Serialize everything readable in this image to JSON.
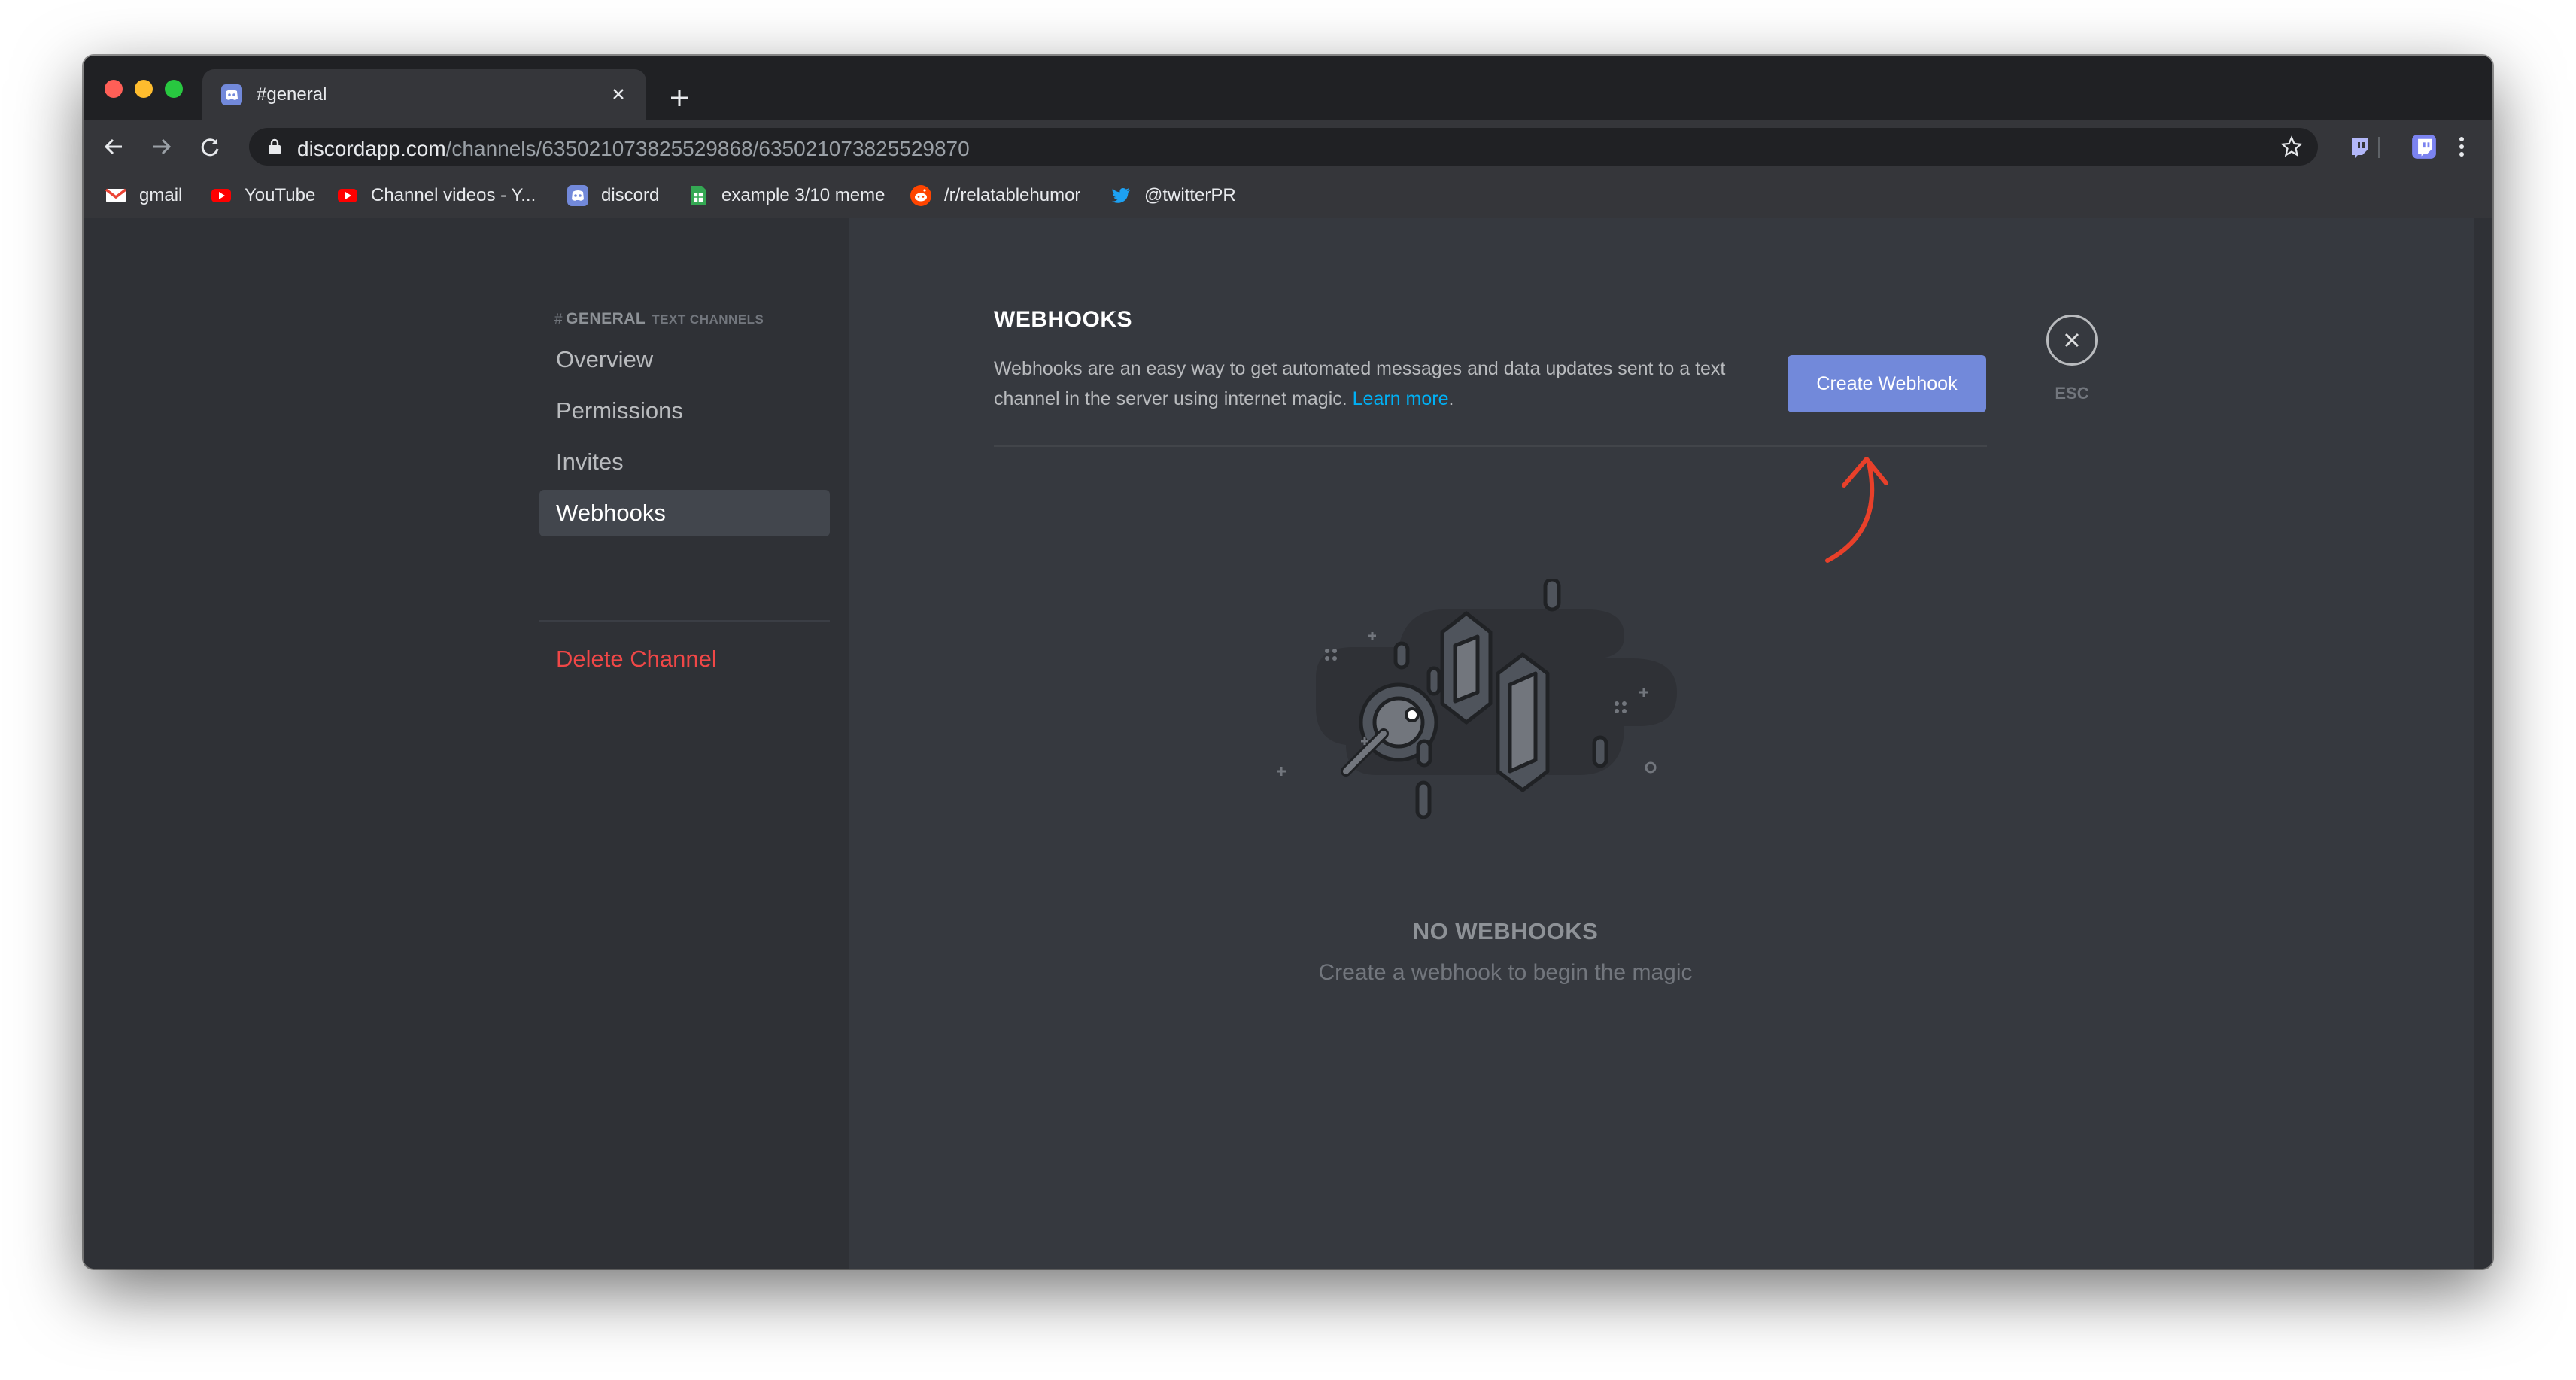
{
  "browser": {
    "tab_title": "#general",
    "url_host": "discordapp.com",
    "url_path": "/channels/635021073825529868/635021073825529870",
    "bookmarks": [
      {
        "label": "gmail",
        "icon": "gmail-icon"
      },
      {
        "label": "YouTube",
        "icon": "youtube-icon"
      },
      {
        "label": "Channel videos - Y...",
        "icon": "youtube-icon"
      },
      {
        "label": "discord",
        "icon": "discord-icon"
      },
      {
        "label": "example 3/10 meme",
        "icon": "sheets-icon"
      },
      {
        "label": "/r/relatablehumor",
        "icon": "reddit-icon"
      },
      {
        "label": "@twitterPR",
        "icon": "twitter-icon"
      }
    ]
  },
  "sidebar": {
    "channel_hash": "#",
    "channel_name": "GENERAL",
    "category": "TEXT CHANNELS",
    "items": [
      {
        "label": "Overview",
        "active": false
      },
      {
        "label": "Permissions",
        "active": false
      },
      {
        "label": "Invites",
        "active": false
      },
      {
        "label": "Webhooks",
        "active": true
      }
    ],
    "delete_label": "Delete Channel"
  },
  "main": {
    "title": "WEBHOOKS",
    "description": "Webhooks are an easy way to get automated messages and data updates sent to a text channel in the server using internet magic.",
    "learn_more": "Learn more",
    "description_end": ".",
    "create_button": "Create Webhook",
    "close_label": "ESC",
    "empty_title": "NO WEBHOOKS",
    "empty_subtitle": "Create a webhook to begin the magic"
  },
  "colors": {
    "blurple": "#7289da",
    "danger": "#f04747",
    "link": "#00b0f4",
    "annotation_arrow": "#e8402a"
  }
}
